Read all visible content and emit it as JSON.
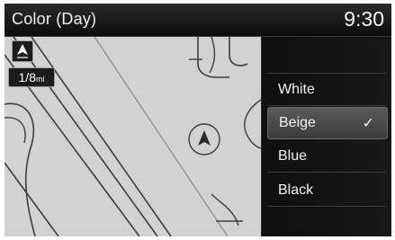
{
  "header": {
    "title": "Color (Day)",
    "clock": "9:30"
  },
  "map": {
    "scale_value": "1/8",
    "scale_unit": "mi",
    "north_indicator": "N"
  },
  "menu": {
    "items": [
      {
        "label": "White",
        "selected": false
      },
      {
        "label": "Beige",
        "selected": true
      },
      {
        "label": "Blue",
        "selected": false
      },
      {
        "label": "Black",
        "selected": false
      }
    ],
    "selected_mark": "✓"
  },
  "colors": {
    "map_background": "#d2d2d2",
    "map_lines": "#3d3d3d",
    "panel_background": "#141414",
    "selected_highlight": "#4a4a4a",
    "text": "#f2f2f2"
  }
}
